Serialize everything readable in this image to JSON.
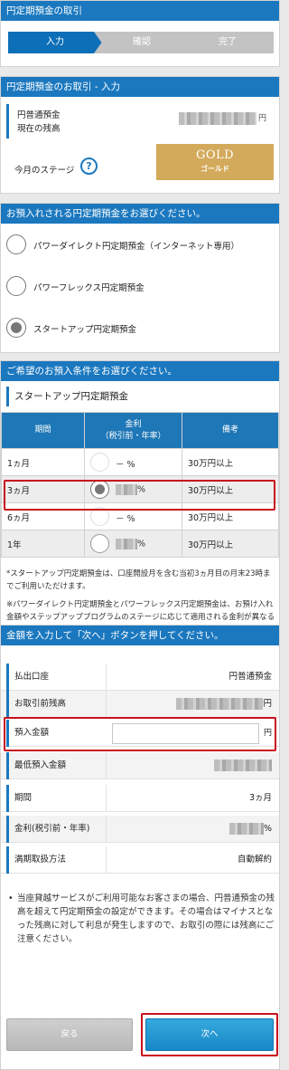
{
  "header": {
    "title": "円定期預金の取引"
  },
  "steps": [
    "入力",
    "確認",
    "完了"
  ],
  "account": {
    "section_title": "円定期預金のお取引 - 入力",
    "balance_label_1": "円普通預金",
    "balance_label_2": "現在の残高",
    "balance_unit": "円",
    "stage_label": "今月のステージ",
    "help_icon": "?",
    "stage_name": "GOLD",
    "stage_sub": "ゴールド",
    "stage_color": "#d3aa5b"
  },
  "product": {
    "section_title": "お預入れされる円定期預金をお選びください。",
    "options": [
      {
        "label": "パワーダイレクト円定期預金（インターネット専用）",
        "selected": false
      },
      {
        "label": "パワーフレックス円定期預金",
        "selected": false
      },
      {
        "label": "スタートアップ円定期預金",
        "selected": true
      }
    ]
  },
  "conditions": {
    "section_title": "ご希望のお預入条件をお選びください。",
    "product_name": "スタートアップ円定期預金",
    "headers": {
      "period": "期間",
      "rate_1": "金利",
      "rate_2": "（税引前・年率）",
      "note": "備考"
    },
    "rows": [
      {
        "period": "1ヵ月",
        "rate": "－ %",
        "note": "30万円以上",
        "selected": false
      },
      {
        "period": "3ヵ月",
        "rate": "%",
        "note": "30万円以上",
        "selected": true
      },
      {
        "period": "6ヵ月",
        "rate": "－ %",
        "note": "30万円以上",
        "selected": false
      },
      {
        "period": "1年",
        "rate": "%",
        "note": "30万円以上",
        "selected": false
      }
    ],
    "note_1": "*スタートアップ円定期預金は、口座開設月を含む当初3ヵ月目の月末23時までご利用いただけます。",
    "note_2": "※パワーダイレクト円定期預金とパワーフレックス円定期預金は、お預け入れ金額やステップアッププログラムのステージに応じて適用される金利が異なる場合があり、同一の預入期間でも金利が異なる場合がございます。"
  },
  "amount": {
    "section_title": "金額を入力して「次へ」ボタンを押してください。",
    "debit_account_label": "払出口座",
    "debit_account_value": "円普通預金",
    "pre_balance_label": "お取引前残高",
    "pre_balance_unit": "円",
    "deposit_label": "預入金額",
    "deposit_value": "",
    "deposit_unit": "円",
    "min_label": "最低預入金額",
    "period_label": "期間",
    "period_value": "3ヵ月",
    "rate_label": "金利(税引前・年率)",
    "rate_unit": "%",
    "maturity_label": "満期取扱方法",
    "maturity_value": "自動解約",
    "notice": "当座貸越サービスがご利用可能なお客さまの場合、円普通預金の残高を超えて円定期預金の設定ができます。その場合はマイナスとなった残高に対して利息が発生しますので、お取引の際には残高にご注意ください。",
    "back_label": "戻る",
    "next_label": "次へ"
  },
  "colors": {
    "accent": "#1b78bf",
    "highlight": "#c8101d",
    "next_button": "#1888c6"
  }
}
